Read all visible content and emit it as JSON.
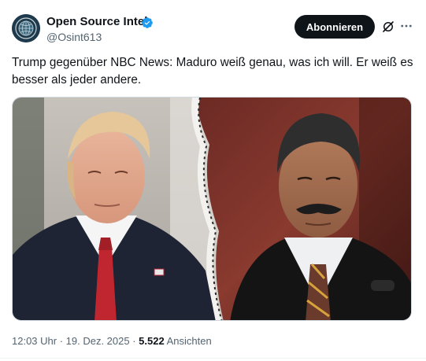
{
  "author": {
    "display_name": "Open Source Intel",
    "handle": "@Osint613",
    "verified": true,
    "avatar_icon": "globe-seal-avatar"
  },
  "actions": {
    "subscribe_label": "Abonnieren",
    "grok_icon": "grok-icon",
    "more_icon": "more-icon"
  },
  "tweet": {
    "text": "Trump gegenüber NBC News: Maduro weiß genau, was ich will. Er weiß es besser als jeder andere."
  },
  "meta": {
    "time": "12:03 Uhr",
    "separator": " · ",
    "date": "19. Dez. 2025",
    "views_count": "5.522",
    "views_label": "Ansichten"
  },
  "colors": {
    "text_primary": "#0f1419",
    "text_secondary": "#536471",
    "verified_blue": "#1d9bf0",
    "button_bg": "#0f1419"
  }
}
